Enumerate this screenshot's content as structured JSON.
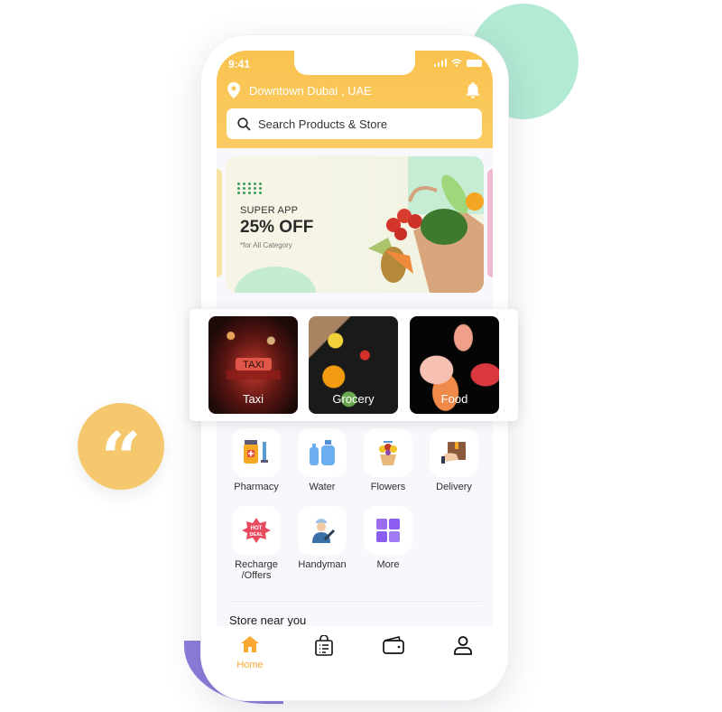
{
  "status_bar": {
    "time": "9:41"
  },
  "header": {
    "location": "Downtown Dubai , UAE",
    "search_placeholder": "Search Products & Store"
  },
  "banner": {
    "kicker": "SUPER APP",
    "headline": "25% OFF",
    "note": "*for All Category"
  },
  "categories": [
    {
      "label": "Taxi"
    },
    {
      "label": "Grocery"
    },
    {
      "label": "Food"
    }
  ],
  "services": [
    {
      "label": "Pharmacy",
      "icon": "pharmacy-icon"
    },
    {
      "label": "Water",
      "icon": "water-bottle-icon"
    },
    {
      "label": "Flowers",
      "icon": "flower-basket-icon"
    },
    {
      "label": "Delivery",
      "icon": "delivery-box-icon"
    },
    {
      "label": "Recharge /Offers",
      "icon": "hot-deal-icon"
    },
    {
      "label": "Handyman",
      "icon": "handyman-icon"
    },
    {
      "label": "More",
      "icon": "grid-icon"
    }
  ],
  "section_title": "Store near you",
  "tabbar": {
    "items": [
      {
        "label": "Home",
        "icon": "home-icon",
        "active": true
      },
      {
        "label": "",
        "icon": "orders-bag-icon"
      },
      {
        "label": "",
        "icon": "wallet-icon"
      },
      {
        "label": "",
        "icon": "profile-icon"
      }
    ]
  },
  "decor": {
    "quote_glyph": "“"
  },
  "colors": {
    "accent": "#F9C34F",
    "active_tab": "#F9A932",
    "mint": "#B2EAD3",
    "purple": "#8C7DDB"
  }
}
